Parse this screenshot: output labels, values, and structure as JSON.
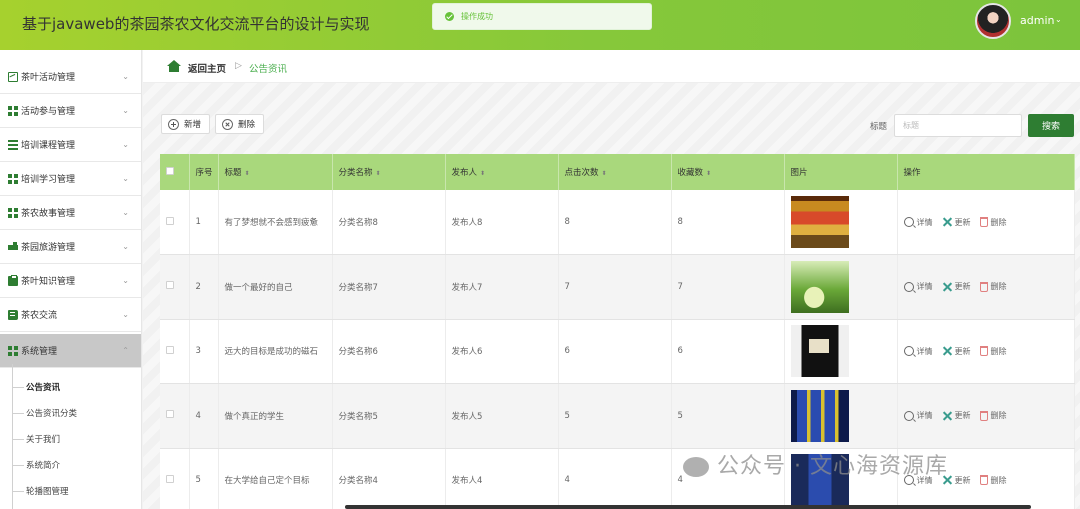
{
  "app": {
    "title": "基于javaweb的茶园茶农文化交流平台的设计与实现"
  },
  "toast": {
    "message": "操作成功"
  },
  "user": {
    "name": "admin"
  },
  "sidebar": {
    "items": [
      {
        "label": "茶叶活动管理",
        "icon": "chart-icon"
      },
      {
        "label": "活动参与管理",
        "icon": "grid-icon"
      },
      {
        "label": "培训课程管理",
        "icon": "list-icon"
      },
      {
        "label": "培训学习管理",
        "icon": "grid-icon"
      },
      {
        "label": "茶农故事管理",
        "icon": "grid-icon"
      },
      {
        "label": "茶园旅游管理",
        "icon": "cart-icon"
      },
      {
        "label": "茶叶知识管理",
        "icon": "clipboard-icon"
      },
      {
        "label": "茶农交流",
        "icon": "book-icon"
      },
      {
        "label": "系统管理",
        "icon": "grid-icon"
      }
    ],
    "submenu": [
      "公告资讯",
      "公告资讯分类",
      "关于我们",
      "系统简介",
      "轮播图管理"
    ]
  },
  "breadcrumb": {
    "home": "返回主页",
    "separator": "▷",
    "current": "公告资讯"
  },
  "toolbar": {
    "add_label": "新增",
    "delete_label": "删除"
  },
  "search": {
    "label": "标题",
    "placeholder": "标题",
    "button": "搜索"
  },
  "table": {
    "headers": [
      "序号",
      "标题",
      "分类名称",
      "发布人",
      "点击次数",
      "收藏数",
      "图片",
      "操作"
    ],
    "rows": [
      {
        "no": "1",
        "title": "有了梦想就不会感到疲惫",
        "category": "分类名称8",
        "publisher": "发布人8",
        "clicks": "8",
        "favorites": "8"
      },
      {
        "no": "2",
        "title": "做一个最好的自己",
        "category": "分类名称7",
        "publisher": "发布人7",
        "clicks": "7",
        "favorites": "7"
      },
      {
        "no": "3",
        "title": "远大的目标是成功的磁石",
        "category": "分类名称6",
        "publisher": "发布人6",
        "clicks": "6",
        "favorites": "6"
      },
      {
        "no": "4",
        "title": "做个真正的学生",
        "category": "分类名称5",
        "publisher": "发布人5",
        "clicks": "5",
        "favorites": "5"
      },
      {
        "no": "5",
        "title": "在大学给自己定个目标",
        "category": "分类名称4",
        "publisher": "发布人4",
        "clicks": "4",
        "favorites": "4"
      }
    ],
    "actions": {
      "detail": "详情",
      "update": "更新",
      "delete": "删除"
    }
  },
  "watermark": {
    "text": "公众号 · 文心海资源库"
  }
}
